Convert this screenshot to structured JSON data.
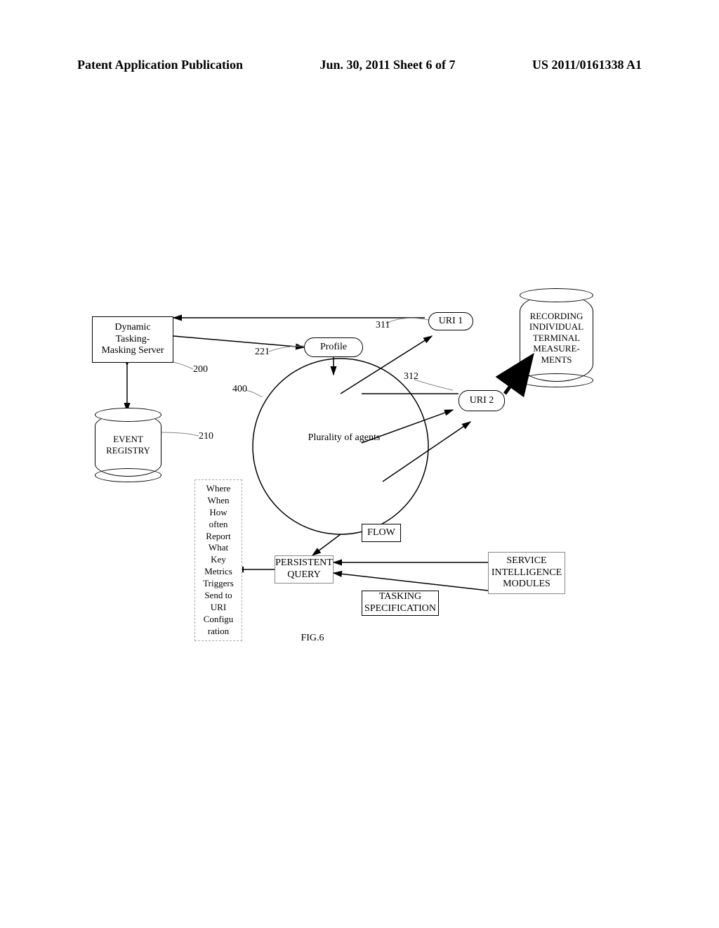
{
  "header": {
    "left": "Patent Application Publication",
    "center": "Jun. 30, 2011  Sheet 6 of 7",
    "right": "US 2011/0161338 A1"
  },
  "diagram": {
    "server": "Dynamic\nTasking-\nMasking Server",
    "event_registry": "EVENT\nREGISTRY",
    "profile": "Profile",
    "uri1": "URI 1",
    "uri2": "URI 2",
    "agents": "Plurality of agents",
    "recording": "RECORDING\nINDIVIDUAL\nTERMINAL\nMEASURE-\nMENTS",
    "persistent_query": "PERSISTENT\nQUERY",
    "flow": "FLOW",
    "tasking_spec": "TASKING\nSPECIFICATION",
    "service_intel": "SERVICE\nINTELLIGENCE\nMODULES",
    "refs": {
      "server": "200",
      "event_registry": "210",
      "profile": "221",
      "uri1": "311",
      "uri2": "312",
      "circle": "400"
    },
    "list_items": [
      "Where",
      "When",
      "How",
      "often",
      "Report",
      "What",
      "Key",
      "Metrics",
      "Triggers",
      "Send to",
      "URI",
      "Configu",
      "ration"
    ],
    "caption": "FIG.6"
  }
}
